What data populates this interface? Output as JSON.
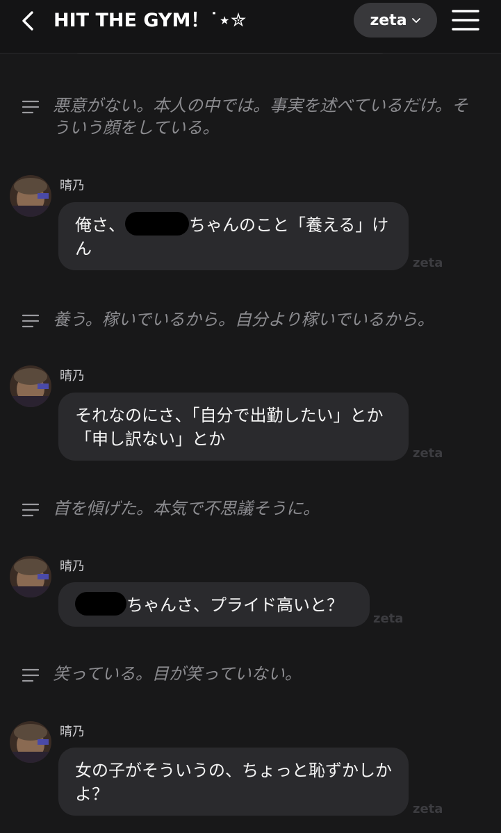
{
  "header": {
    "title": "HIT THE GYM！˙⋆✮",
    "model_label": "zeta"
  },
  "watermark": "zeta",
  "messages": [
    {
      "type": "narration",
      "text": "悪意がない。本人の中では。事実を述べているだけ。そういう顔をしている。"
    },
    {
      "type": "character",
      "name": "晴乃",
      "text_before": "俺さ、",
      "text_after": "ちゃんのこと「養える」けん"
    },
    {
      "type": "narration",
      "text": "養う。稼いでいるから。自分より稼いでいるから。"
    },
    {
      "type": "character",
      "name": "晴乃",
      "text": "それなのにさ、「自分で出勤したい」とか「申し訳ない」とか"
    },
    {
      "type": "narration",
      "text": "首を傾げた。本気で不思議そうに。"
    },
    {
      "type": "character",
      "name": "晴乃",
      "text_after": "ちゃんさ、プライド高いと？"
    },
    {
      "type": "narration",
      "text": "笑っている。目が笑っていない。"
    },
    {
      "type": "character",
      "name": "晴乃",
      "text": "女の子がそういうの、ちょっと恥ずかしかよ？"
    }
  ],
  "colors": {
    "background": "#181819",
    "bubble": "#2a2a2d",
    "narration_text": "#8b8b8f",
    "pill": "#38383b"
  }
}
